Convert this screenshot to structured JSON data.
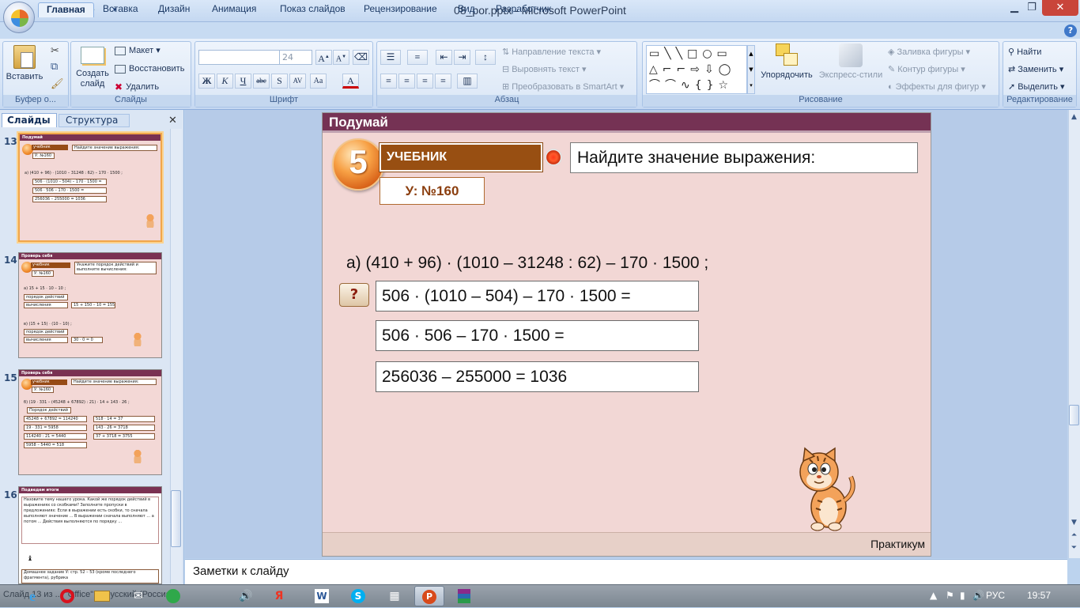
{
  "window": {
    "title": "08_por.pptx - Microsoft PowerPoint",
    "minimize_icon": "minimize-icon",
    "restore_icon": "restore-icon",
    "close_icon": "close-icon"
  },
  "ribbon": {
    "tabs": [
      "Главная",
      "Вставка",
      "Дизайн",
      "Анимация",
      "Показ слайдов",
      "Рецензирование",
      "Вид",
      "Разработчик"
    ],
    "active_tab": "Главная",
    "clipboard": {
      "label": "Буфер о...",
      "paste": "Вставить"
    },
    "slides": {
      "label": "Слайды",
      "new_slide": "Создать слайд",
      "layout": "Макет",
      "reset": "Восстановить",
      "delete": "Удалить"
    },
    "font": {
      "label": "Шрифт",
      "font_name": "",
      "font_size": "24"
    },
    "paragraph": {
      "label": "Абзац",
      "text_direction": "Направление текста",
      "align_text": "Выровнять текст",
      "smartart": "Преобразовать в SmartArt"
    },
    "drawing": {
      "label": "Рисование",
      "arrange": "Упорядочить",
      "quick_styles": "Экспресс-стили",
      "shape_fill": "Заливка фигуры",
      "shape_outline": "Контур фигуры",
      "shape_effects": "Эффекты для фигур"
    },
    "editing": {
      "label": "Редактирование",
      "find": "Найти",
      "replace": "Заменить",
      "select": "Выделить"
    }
  },
  "left_panel": {
    "tabs": [
      "Слайды",
      "Структура"
    ],
    "thumbnails": [
      {
        "number": "13",
        "title": "Подумай",
        "selected": true
      },
      {
        "number": "14",
        "title": "Проверь себя",
        "selected": false
      },
      {
        "number": "15",
        "title": "Проверь себя",
        "selected": false
      },
      {
        "number": "16",
        "title": "Подведем итоги",
        "selected": false
      }
    ]
  },
  "slide": {
    "header": "Подумай",
    "number": "5",
    "textbook_label": "УЧЕБНИК",
    "task": "Найдите значение выражения:",
    "reference": "У: №160",
    "expression": "а) (410 + 96) · (1010 – 31248 : 62) – 170 · 1500 ;",
    "question_mark": "?",
    "steps": [
      "506 · (1010 – 504) – 170 · 1500 =",
      "506 · 506 – 170 · 1500 =",
      "256036 – 255000 = 1036"
    ],
    "footer": "Практикум"
  },
  "notes": {
    "placeholder": "Заметки к слайду"
  },
  "status": {
    "text": "Слайд 13 из ... \"Office\" ... русский (Россия)"
  },
  "tray": {
    "lang": "РУС",
    "time": "19:57"
  },
  "colors": {
    "slide_bg": "#f2d7d5",
    "header": "#753254",
    "textbook_brown": "#984f12",
    "accent_orange": "#f7a044"
  }
}
